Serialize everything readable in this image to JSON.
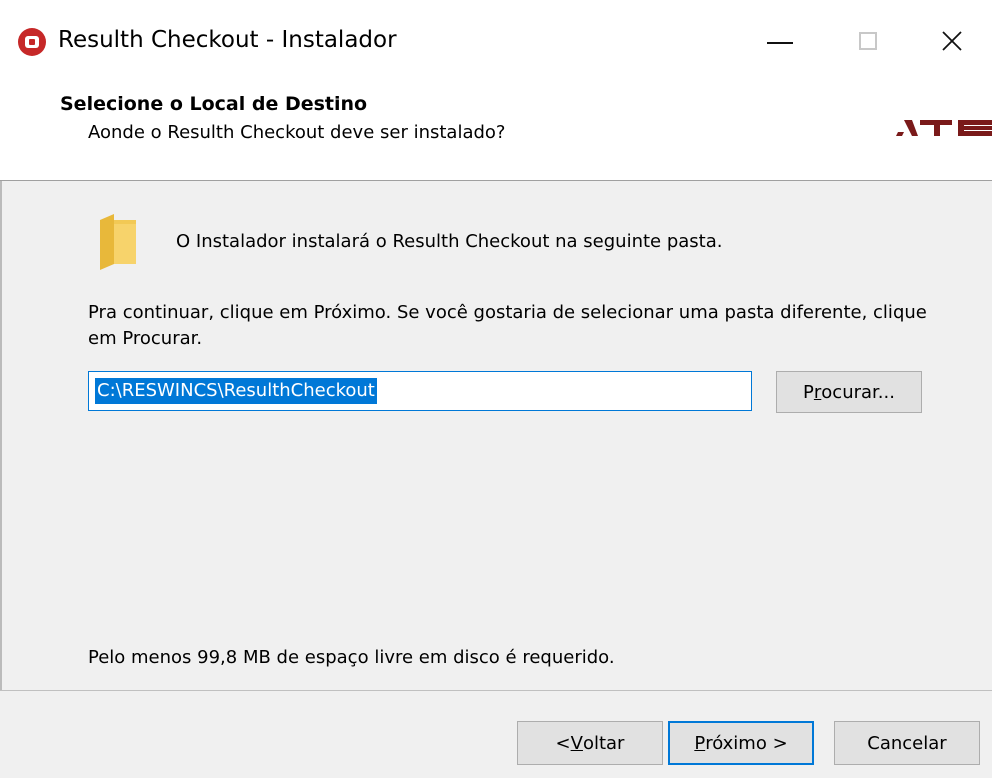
{
  "window": {
    "title": "Resulth Checkout - Instalador",
    "icon": "app-record-icon",
    "controls": {
      "minimize": "minimize-icon",
      "maximize": "maximize-icon",
      "close": "close-icon"
    }
  },
  "header": {
    "title": "Selecione o Local de Destino",
    "subtitle": "Aonde o Resulth Checkout deve ser instalado?",
    "logo_color": "#7a1a1a"
  },
  "content": {
    "intro": "O Instalador instalará o Resulth Checkout na seguinte pasta.",
    "instructions": "Pra continuar, clique em Próximo. Se você gostaria de selecionar uma pasta diferente, clique em Procurar.",
    "path_value": "C:\\RESWINCS\\ResulthCheckout",
    "browse": {
      "pre": "P",
      "underline": "r",
      "post": "ocurar..."
    },
    "space_required": "Pelo menos 99,8 MB de espaço livre em disco é requerido."
  },
  "footer": {
    "back": {
      "pre": "< ",
      "underline": "V",
      "post": "oltar"
    },
    "next": {
      "pre": "",
      "underline": "P",
      "post": "róximo >"
    },
    "cancel": "Cancelar"
  },
  "colors": {
    "accent": "#0078d7",
    "app_icon": "#c62828",
    "folder": "#f4c542"
  }
}
